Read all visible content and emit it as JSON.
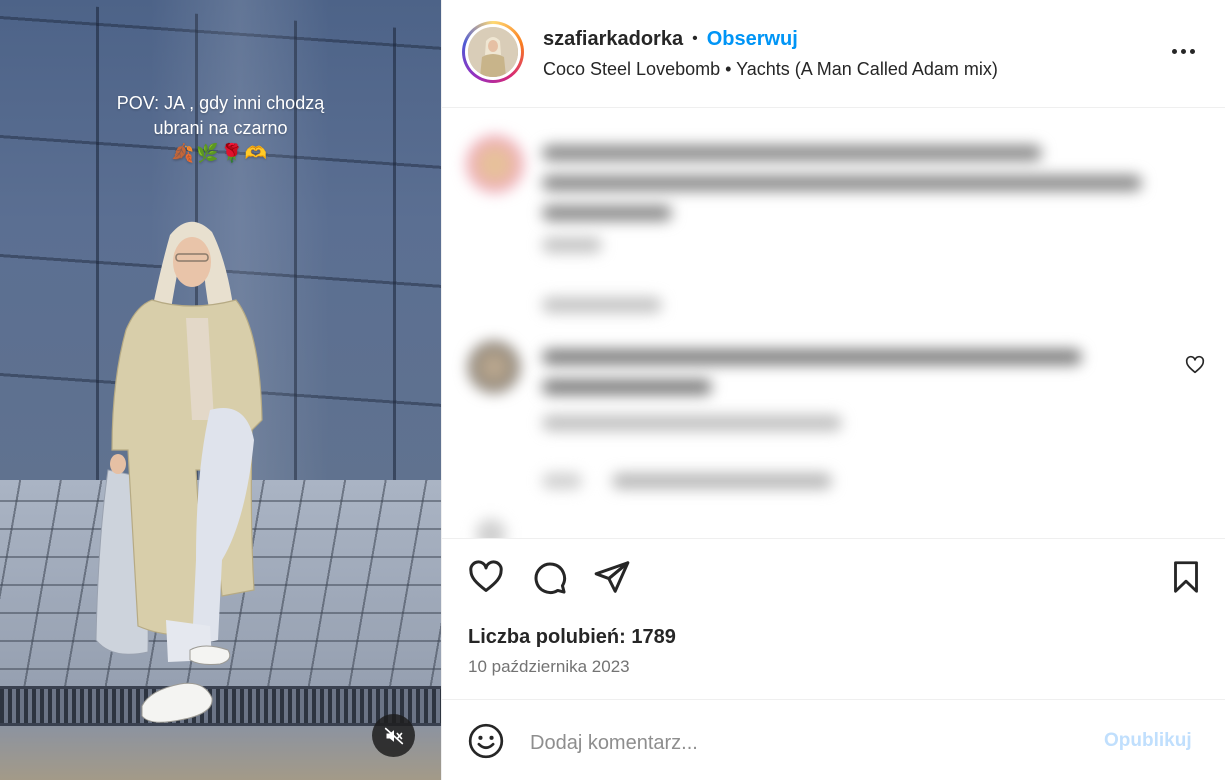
{
  "media": {
    "overlay_line1": "POV: JA , gdy inni chodzą",
    "overlay_line2": "ubrani na czarno",
    "overlay_emoji": "🍂🌿🌹🫶",
    "mute_icon": "speaker-muted-icon"
  },
  "header": {
    "username": "szafiarkadorka",
    "separator": "•",
    "follow_label": "Obserwuj",
    "audio": "Coco Steel Lovebomb • Yachts (A Man Called Adam mix)",
    "more_icon": "more-horizontal-icon"
  },
  "actions": {
    "like_icon": "heart-icon",
    "comment_icon": "comment-icon",
    "share_icon": "send-icon",
    "save_icon": "bookmark-icon"
  },
  "stats": {
    "likes": "Liczba polubień: 1789",
    "date": "10 października 2023"
  },
  "comment_bar": {
    "emoji_icon": "emoji-icon",
    "placeholder": "Dodaj komentarz...",
    "publish_label": "Opublikuj"
  },
  "colors": {
    "link_blue": "#0095f6",
    "publish_disabled": "#c0dffd",
    "text_primary": "#262626",
    "text_secondary": "#737373",
    "divider": "#efefef"
  }
}
